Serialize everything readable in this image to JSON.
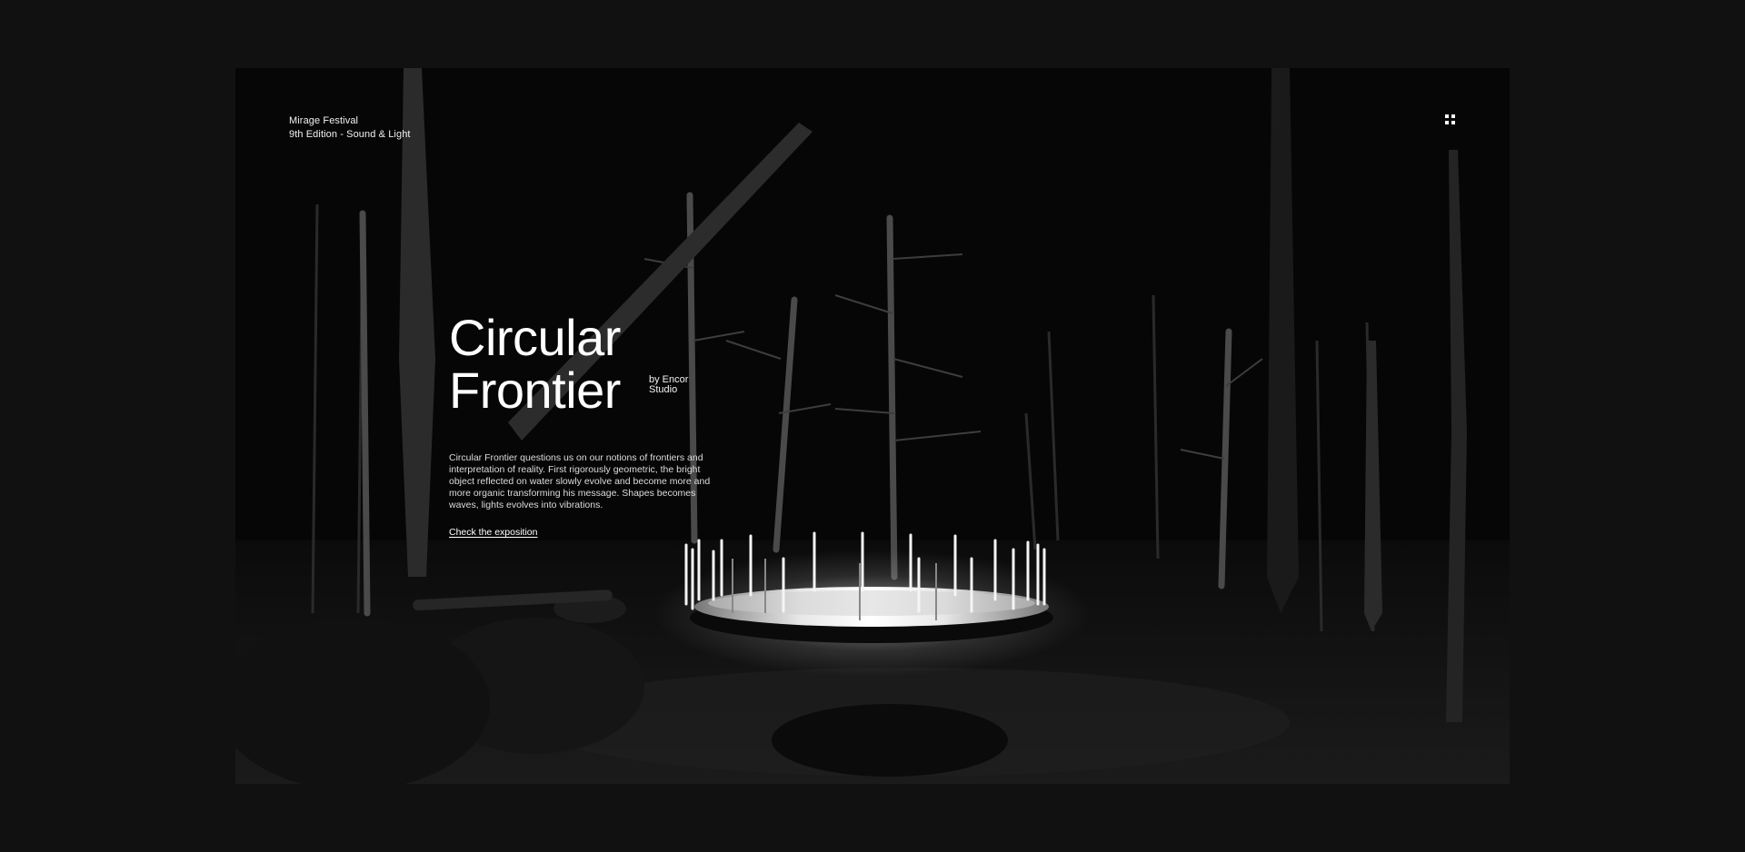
{
  "brand": {
    "name": "Mirage Festival",
    "edition": "9th Edition - Sound & Light"
  },
  "menu": {
    "icon": "grid-menu-icon"
  },
  "hero": {
    "title_line1": "Circular",
    "title_line2": "Frontier",
    "byline_line1": "by Encor",
    "byline_line2": "Studio",
    "description": "Circular Frontier questions us on our notions of frontiers and interpretation of reality. First rigorously geometric, the bright object reflected on water slowly evolve and become more and more organic transforming his message. Shapes becomes waves, lights evolves into vibrations.",
    "cta_label": "Check the exposition"
  },
  "colors": {
    "page_background": "#111111",
    "scene_background": "#060606",
    "text": "#ffffff"
  }
}
